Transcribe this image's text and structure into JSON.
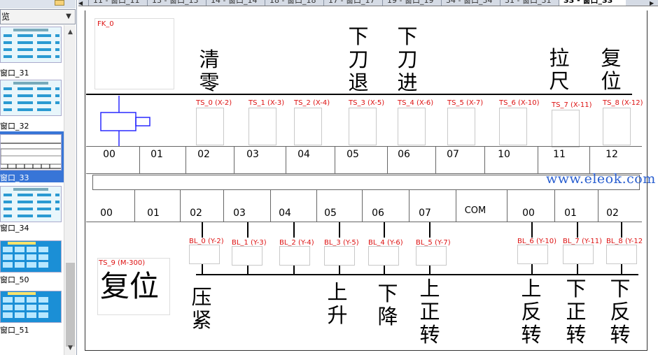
{
  "sidebar": {
    "title": "览",
    "items": [
      {
        "label": "窗口_31"
      },
      {
        "label": "窗口_32"
      },
      {
        "label": "窗口_33"
      },
      {
        "label": "窗口_34"
      },
      {
        "label": "窗口_50"
      },
      {
        "label": "窗口_51"
      }
    ]
  },
  "tabs": [
    {
      "label": "11 - 窗口_11"
    },
    {
      "label": "13 - 窗口_13"
    },
    {
      "label": "14 - 窗口_14"
    },
    {
      "label": "18 - 窗口_18"
    },
    {
      "label": "17 - 窗口_17"
    },
    {
      "label": "19 - 窗口_19"
    },
    {
      "label": "34 - 窗口_34"
    },
    {
      "label": "31 - 窗口_31"
    },
    {
      "label": "33 - 窗口_33"
    }
  ],
  "canvas": {
    "fk_label": "FK_0",
    "top_titles": [
      "清零",
      "下刀退",
      "下刀进",
      "拉尺",
      "复位"
    ],
    "ts_labels": [
      "TS_0 (X-2)",
      "TS_1 (X-3)",
      "TS_2 (X-4)",
      "TS_3 (X-5)",
      "TS_4 (X-6)",
      "TS_5 (X-7)",
      "TS_6 (X-10)",
      "TS_7 (X-11)",
      "TS_8 (X-12)"
    ],
    "input_terminals": [
      "00",
      "01",
      "02",
      "03",
      "04",
      "05",
      "06",
      "07",
      "10",
      "11",
      "12"
    ],
    "output_terminals": [
      "00",
      "01",
      "02",
      "03",
      "04",
      "05",
      "06",
      "07",
      "COM",
      "00",
      "01",
      "02"
    ],
    "bl_labels": [
      "BL_0 (Y-2)",
      "BL_1 (Y-3)",
      "BL_2 (Y-4)",
      "BL_3 (Y-5)",
      "BL_4 (Y-6)",
      "BL_5 (Y-7)",
      "BL_6 (Y-10)",
      "BL_7 (Y-11)",
      "BL_8 (Y-12"
    ],
    "ts9_label": "TS_9 (M-300)",
    "reset_label": "复位",
    "bottom_titles": [
      "压紧",
      "上升",
      "下降",
      "上正转",
      "上反转",
      "下正转",
      "下反转"
    ],
    "watermark": "www.eleok.com"
  },
  "colors": {
    "accent_red": "#d11111",
    "selected_blue": "#3875d7",
    "watermark_blue": "#2a5fd0",
    "cylinder_blue": "#2a2aff"
  }
}
